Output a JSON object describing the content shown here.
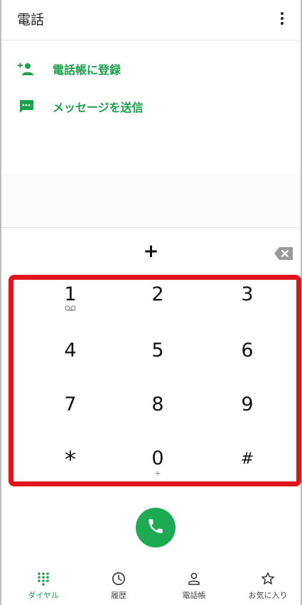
{
  "appbar": {
    "title": "電話"
  },
  "actions": [
    {
      "label": "電話帳に登録",
      "icon": "add-contact-icon"
    },
    {
      "label": "メッセージを送信",
      "icon": "message-icon"
    }
  ],
  "input": {
    "value": "+"
  },
  "keypad": {
    "keys": [
      {
        "num": "1",
        "sub": ""
      },
      {
        "num": "2",
        "sub": ""
      },
      {
        "num": "3",
        "sub": ""
      },
      {
        "num": "4",
        "sub": ""
      },
      {
        "num": "5",
        "sub": ""
      },
      {
        "num": "6",
        "sub": ""
      },
      {
        "num": "7",
        "sub": ""
      },
      {
        "num": "8",
        "sub": ""
      },
      {
        "num": "9",
        "sub": ""
      },
      {
        "num": "*",
        "sub": ""
      },
      {
        "num": "0",
        "sub": "+"
      },
      {
        "num": "#",
        "sub": ""
      }
    ]
  },
  "nav": {
    "items": [
      {
        "label": "ダイヤル",
        "icon": "dialpad-icon",
        "active": true
      },
      {
        "label": "履歴",
        "icon": "clock-icon",
        "active": false
      },
      {
        "label": "電話帳",
        "icon": "person-icon",
        "active": false
      },
      {
        "label": "お気に入り",
        "icon": "star-icon",
        "active": false
      }
    ]
  },
  "colors": {
    "accent": "#1aa14a",
    "call": "#1eaa53",
    "highlight": "#e2141b"
  }
}
